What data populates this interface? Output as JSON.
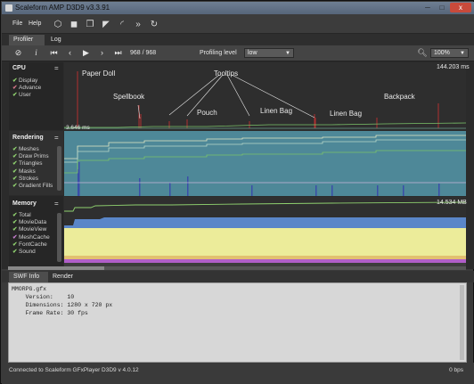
{
  "window": {
    "title": "Scaleform AMP D3D9 v3.3.91",
    "minimize_glyph": "─",
    "maximize_glyph": "□",
    "close_glyph": "x"
  },
  "menu": {
    "file": "File",
    "help": "Help"
  },
  "toolbar_icons": [
    "cube-icon",
    "cube-stack-icon",
    "layers-icon",
    "arrow-select-icon",
    "arc-icon",
    "double-chevron-icon",
    "refresh-icon"
  ],
  "tabs": {
    "profiler": "Profiler",
    "log": "Log"
  },
  "controls": {
    "frame_counter": "968 / 968",
    "profiling_label": "Profiling level",
    "profiling_value": "low",
    "zoom_value": "100%"
  },
  "cpu": {
    "title": "CPU",
    "toggle": "=",
    "items": [
      {
        "label": "Display",
        "color": "#8fd16f"
      },
      {
        "label": "Advance",
        "color": "#d6768a"
      },
      {
        "label": "User",
        "color": "#8fd16f"
      }
    ],
    "max_value": "144.203 ms",
    "ref_value": "3.646 ms"
  },
  "rendering": {
    "title": "Rendering",
    "toggle": "=",
    "items": [
      {
        "label": "Meshes",
        "color": "#8fd16f"
      },
      {
        "label": "Draw Prims",
        "color": "#8fd16f"
      },
      {
        "label": "Triangles",
        "color": "#8fd16f"
      },
      {
        "label": "Masks",
        "color": "#8fd16f"
      },
      {
        "label": "Strokes",
        "color": "#8fd16f"
      },
      {
        "label": "Gradient Fills",
        "color": "#8fd16f"
      }
    ]
  },
  "memory": {
    "title": "Memory",
    "toggle": "=",
    "items": [
      {
        "label": "Total",
        "color": "#8fd16f"
      },
      {
        "label": "MovieData",
        "color": "#8fd16f"
      },
      {
        "label": "MovieView",
        "color": "#8fd16f"
      },
      {
        "label": "MeshCache",
        "color": "#c77fd0"
      },
      {
        "label": "FontCache",
        "color": "#8fd16f"
      },
      {
        "label": "Sound",
        "color": "#8fd16f"
      }
    ],
    "max_value": "14.534 MB"
  },
  "annotations": {
    "paper_doll": "Paper Doll",
    "tooltips": "Tooltips",
    "spellbook": "Spellbook",
    "pouch": "Pouch",
    "linen_bag_1": "Linen Bag",
    "linen_bag_2": "Linen Bag",
    "backpack": "Backpack"
  },
  "colors": {
    "cpu_spike": "#b03030",
    "cpu_line": "#7bc46a",
    "render_bg": "#4e8898",
    "render_line": "#d8e0b0",
    "mem_yellow": "#ecec9a",
    "mem_blue": "#5a86c8",
    "mem_purple": "#b05ec8",
    "mem_green": "#8fd16f"
  },
  "info_tabs": {
    "swf": "SWF Info",
    "render": "Render"
  },
  "swf_info": {
    "file": "MMORPG.gfx",
    "version": "    Version:    10",
    "dimensions": "    Dimensions: 1280 x 720 px",
    "frame_rate": "    Frame Rate: 30 fps"
  },
  "status": {
    "connection": "Connected to Scaleform GFxPlayer D3D9 v 4.0.12",
    "rate": "0 bps"
  }
}
